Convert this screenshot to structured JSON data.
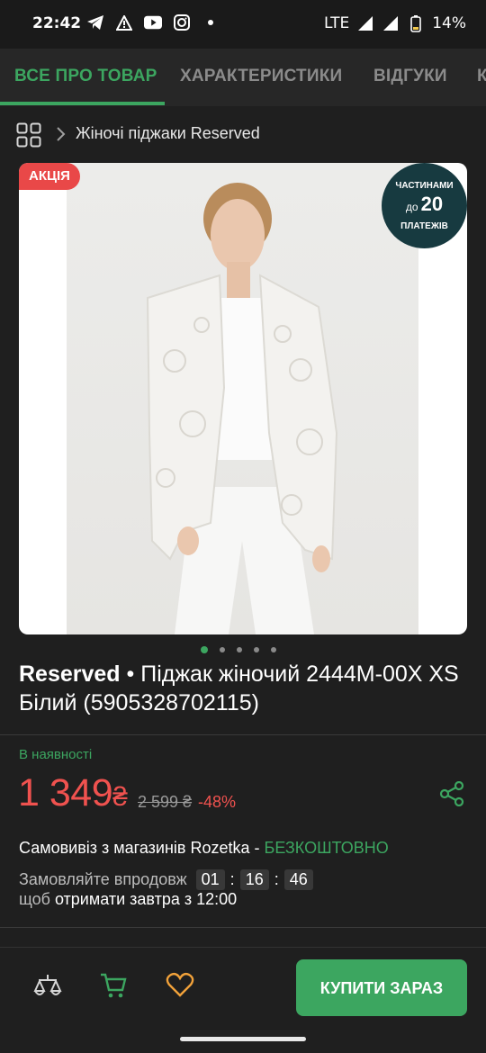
{
  "status_bar": {
    "time": "22:42",
    "network": "LTE",
    "battery": "14%",
    "icons": [
      "telegram-icon",
      "alert-icon",
      "youtube-icon",
      "instagram-icon",
      "dot-icon",
      "signal-icon",
      "battery-icon"
    ]
  },
  "tabs": [
    {
      "label": "ВСЕ ПРО ТОВАР",
      "active": true
    },
    {
      "label": "ХАРАКТЕРИСТИКИ",
      "active": false
    },
    {
      "label": "ВІДГУКИ",
      "active": false
    },
    {
      "label": "К",
      "active": false
    }
  ],
  "breadcrumb": {
    "label": "Жіночі піджаки Reserved"
  },
  "product": {
    "sale_badge": "АКЦІЯ",
    "installment": {
      "line1": "ЧАСТИНАМИ",
      "line2_prefix": "до",
      "line2_number": "20",
      "line3": "ПЛАТЕЖІВ"
    },
    "gallery_count": 5,
    "gallery_active_index": 0,
    "brand": "Reserved",
    "name": " • Піджак жіночий 2444M-00X XS Білий (5905328702115)",
    "stock": "В наявності",
    "price": "1 349",
    "currency": "₴",
    "old_price": "2 599 ₴",
    "discount": "-48%",
    "pickup_text": "Самовивіз з магазинів Rozetka - ",
    "pickup_free": "БЕЗКОШТОВНО",
    "order_prefix": "Замовляйте впродовж",
    "timer": {
      "h": "01",
      "m": "16",
      "s": "46"
    },
    "tomorrow_prefix": "щоб ",
    "tomorrow_text": "отримати завтра з 12:00"
  },
  "bottom_bar": {
    "buy_label": "КУПИТИ ЗАРАЗ"
  },
  "colors": {
    "accent": "#3ca660",
    "sale": "#e94848",
    "price": "#f0524f",
    "background": "#1f1f1f",
    "heart": "#f2a23a"
  }
}
